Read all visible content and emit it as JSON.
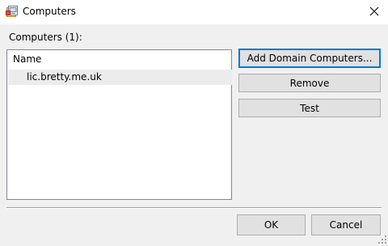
{
  "window": {
    "title": "Computers",
    "icon": "computers-dialog-icon",
    "close_icon": "close-icon"
  },
  "section": {
    "label": "Computers (1):"
  },
  "list": {
    "column_header": "Name",
    "items": [
      {
        "name": "lic.bretty.me.uk",
        "selected": true
      }
    ]
  },
  "side_buttons": {
    "add_label": "Add Domain Computers...",
    "remove_label": "Remove",
    "test_label": "Test"
  },
  "footer_buttons": {
    "ok_label": "OK",
    "cancel_label": "Cancel"
  },
  "colors": {
    "focus_border": "#0078d7",
    "button_face": "#e1e1e1",
    "dialog_background": "#f0f0f0",
    "selected_row": "#ececec"
  }
}
